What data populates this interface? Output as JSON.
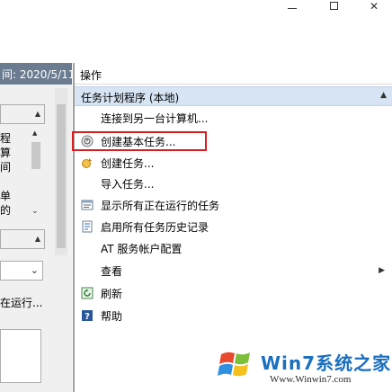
{
  "window": {
    "minimize_glyph": "—",
    "close_glyph": "✕"
  },
  "left_pane": {
    "header_text": "间: 2020/5/11",
    "truncated_chars": [
      "程",
      "算",
      "间",
      "",
      "单",
      "的"
    ],
    "running_text": "在运行..."
  },
  "actions": {
    "title": "操作",
    "section": "任务计划程序 (本地)",
    "items": [
      {
        "label": "连接到另一台计算机...",
        "icon": "none"
      },
      {
        "label": "创建基本任务...",
        "icon": "basic-task-icon"
      },
      {
        "label": "创建任务...",
        "icon": "create-task-icon"
      },
      {
        "label": "导入任务...",
        "icon": "none"
      },
      {
        "label": "显示所有正在运行的任务",
        "icon": "running-tasks-icon"
      },
      {
        "label": "启用所有任务历史记录",
        "icon": "task-history-icon"
      },
      {
        "label": "AT 服务帐户配置",
        "icon": "none"
      },
      {
        "label": "查看",
        "icon": "none",
        "submenu": true
      },
      {
        "label": "刷新",
        "icon": "refresh-icon"
      },
      {
        "label": "帮助",
        "icon": "help-icon"
      }
    ]
  },
  "watermark": {
    "text": "Win7系统之家",
    "url": "Www.Winwin7.com"
  },
  "colors": {
    "highlight_border": "#d81e1e",
    "section_bg": "#d6e4f3",
    "left_header_bg": "#6b7c91"
  }
}
